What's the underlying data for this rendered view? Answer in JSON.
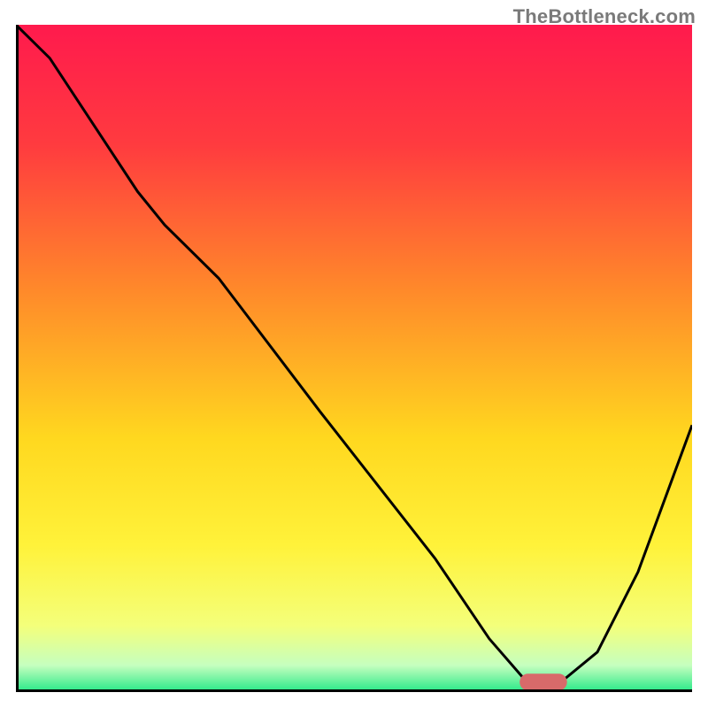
{
  "watermark": "TheBottleneck.com",
  "chart_data": {
    "type": "line",
    "title": "",
    "xlabel": "",
    "ylabel": "",
    "xlim": [
      0,
      100
    ],
    "ylim": [
      0,
      100
    ],
    "grid": false,
    "legend": false,
    "gradient_stops": [
      {
        "offset": 0.0,
        "color": "#ff1a4d"
      },
      {
        "offset": 0.18,
        "color": "#ff3b3f"
      },
      {
        "offset": 0.4,
        "color": "#ff8a2a"
      },
      {
        "offset": 0.62,
        "color": "#ffd81f"
      },
      {
        "offset": 0.78,
        "color": "#fff23a"
      },
      {
        "offset": 0.9,
        "color": "#f4ff7a"
      },
      {
        "offset": 0.96,
        "color": "#c6ffbf"
      },
      {
        "offset": 1.0,
        "color": "#25e887"
      }
    ],
    "series": [
      {
        "name": "bottleneck-curve",
        "x": [
          0,
          5,
          18,
          22,
          30,
          45,
          62,
          70,
          76,
          80,
          86,
          92,
          100
        ],
        "y": [
          100,
          95,
          75,
          70,
          62,
          42,
          20,
          8,
          1,
          1,
          6,
          18,
          40
        ]
      }
    ],
    "marker": {
      "name": "optimal-zone",
      "x_center": 78,
      "y": 1.5,
      "width": 7,
      "height": 2.5,
      "color": "#d86a6a"
    },
    "axes_color": "#000000",
    "axes_width": 3
  }
}
